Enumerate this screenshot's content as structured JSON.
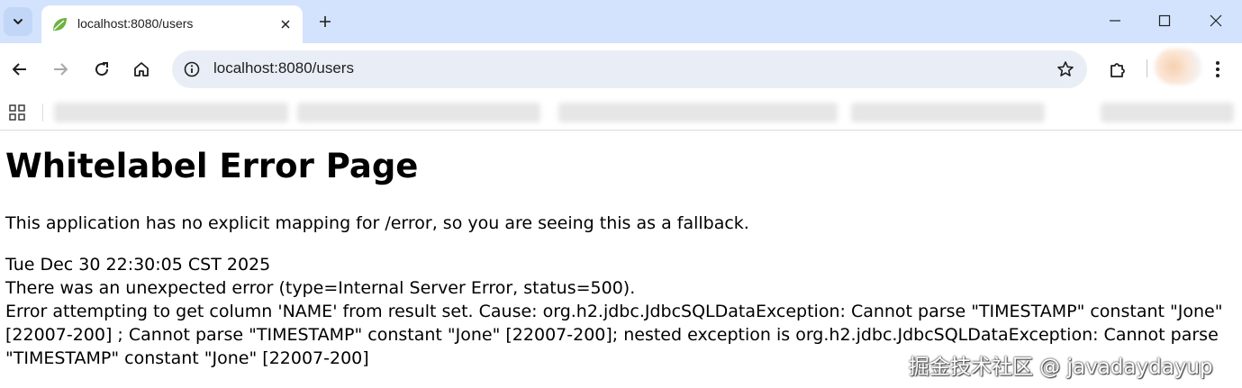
{
  "browser": {
    "tab": {
      "title": "localhost:8080/users"
    },
    "address_bar": {
      "host": "localhost",
      "rest": ":8080/users"
    }
  },
  "page": {
    "heading": "Whitelabel Error Page",
    "message": "This application has no explicit mapping for /error, so you are seeing this as a fallback.",
    "timestamp": "Tue Dec 30 22:30:05 CST 2025",
    "error_summary": "There was an unexpected error (type=Internal Server Error, status=500).",
    "error_line_1": "Error attempting to get column 'NAME' from result set. Cause: org.h2.jdbc.JdbcSQLDataException: Cannot parse \"TIMESTAMP\" constant \"Jone\"",
    "error_line_2": "[22007-200] ; Cannot parse \"TIMESTAMP\" constant \"Jone\" [22007-200]; nested exception is org.h2.jdbc.JdbcSQLDataException: Cannot parse",
    "error_line_3": "\"TIMESTAMP\" constant \"Jone\" [22007-200]"
  },
  "watermark": "掘金技术社区 @ javadaydayup",
  "icons": {
    "tab_menu": "chevron-down-icon",
    "favicon": "spring-leaf-icon",
    "tab_close": "close-icon",
    "new_tab": "plus-icon",
    "minimize": "minimize-icon",
    "maximize": "maximize-icon",
    "close_window": "close-icon",
    "back": "arrow-left-icon",
    "forward": "arrow-right-icon",
    "reload": "reload-icon",
    "home": "home-icon",
    "site_info": "site-info-icon",
    "bookmark": "star-icon",
    "extensions": "puzzle-icon",
    "menu": "more-vertical-icon",
    "apps": "apps-grid-icon"
  },
  "colors": {
    "tabstrip": "#d3e3fd",
    "omnibox": "#e9eef6",
    "favicon": "#6db33f"
  }
}
